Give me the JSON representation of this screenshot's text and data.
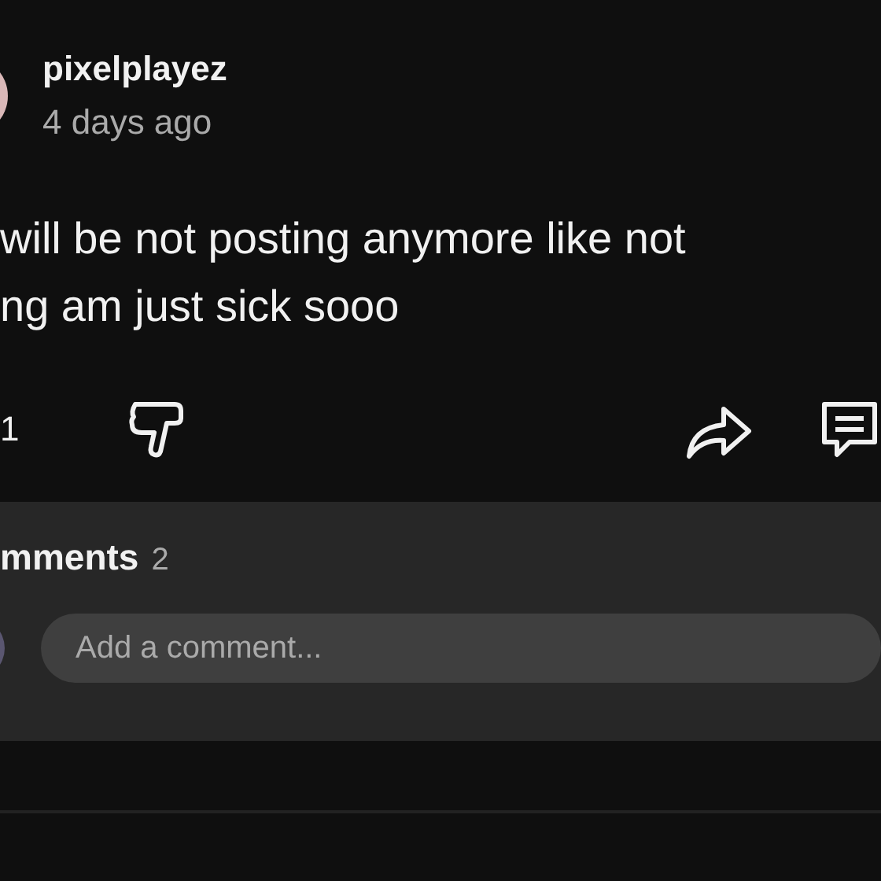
{
  "post": {
    "author": "pixelplayez",
    "time": "4 days ago",
    "text_lines": [
      "will be not posting anymore like not",
      "ng am just sick sooo"
    ],
    "like_count": "1"
  },
  "comments": {
    "heading": "mments",
    "count": "2",
    "input": {
      "placeholder": "Add a comment..."
    }
  }
}
